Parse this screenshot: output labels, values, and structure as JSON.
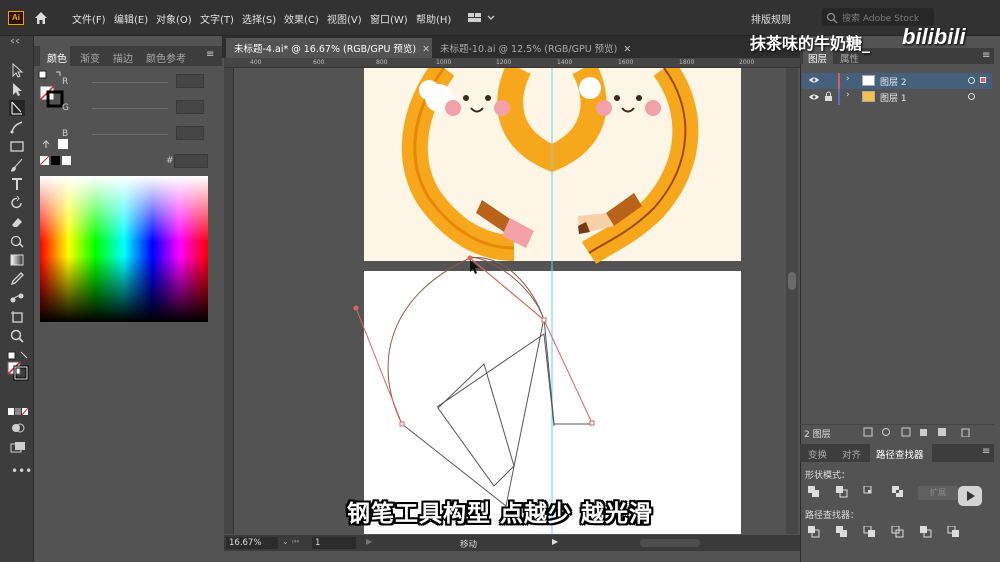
{
  "app": {
    "logo": "Ai",
    "home_icon": "home-icon"
  },
  "menu": [
    "文件(F)",
    "编辑(E)",
    "对象(O)",
    "文字(T)",
    "选择(S)",
    "效果(C)",
    "视图(V)",
    "窗口(W)",
    "帮助(H)"
  ],
  "top_right": {
    "arrange": "排版规则",
    "search_placeholder": "搜索 Adobe Stock"
  },
  "tools": [
    "selection-tool-icon",
    "direct-selection-tool-icon",
    "pen-tool-icon",
    "curvature-tool-icon",
    "rectangle-tool-icon",
    "paintbrush-tool-icon",
    "type-tool-icon",
    "rotate-tool-icon",
    "eraser-tool-icon",
    "shape-builder-tool-icon",
    "gradient-tool-icon",
    "eyedropper-tool-icon",
    "blend-tool-icon",
    "artboard-tool-icon",
    "zoom-tool-icon"
  ],
  "color_panel": {
    "tabs": [
      "颜色",
      "渐变",
      "描边",
      "颜色参考"
    ],
    "channels": [
      "R",
      "G",
      "B"
    ],
    "hex_prefix": "#"
  },
  "documents": [
    {
      "title": "未标题-4.ai* @ 16.67% (RGB/GPU 预览)",
      "active": true
    },
    {
      "title": "未标题-10.ai @ 12.5% (RGB/GPU 预览)",
      "active": false
    }
  ],
  "ruler_marks": [
    "400",
    "600",
    "800",
    "1000",
    "1200",
    "1400",
    "1600",
    "1800",
    "2000"
  ],
  "status": {
    "zoom": "16.67%",
    "page": "1",
    "tool": "移动"
  },
  "layers_panel": {
    "tabs": [
      "图层",
      "属性"
    ],
    "layers": [
      {
        "name": "图层 2",
        "color": "#e05a5a",
        "selected": true
      },
      {
        "name": "图层 1",
        "color": "#4f6fd8",
        "selected": false
      }
    ],
    "count": "2 图层"
  },
  "pathfinder_panel": {
    "tabs": [
      "变换",
      "对齐",
      "路径查找器"
    ],
    "shape_modes_label": "形状模式：",
    "pathfinders_label": "路径查找器：",
    "expand": "扩展"
  },
  "overlay": {
    "subtitle": "钢笔工具构型  点越少 越光滑",
    "author": "抹茶味的牛奶糖_",
    "logo": "bilibili"
  },
  "colors": {
    "accent_orange": "#f7a71c",
    "dark_orange": "#e8860a",
    "artboard_bg": "#fdf5e6",
    "path_red": "#d9675a",
    "guide_cyan": "#6ad3e8"
  }
}
